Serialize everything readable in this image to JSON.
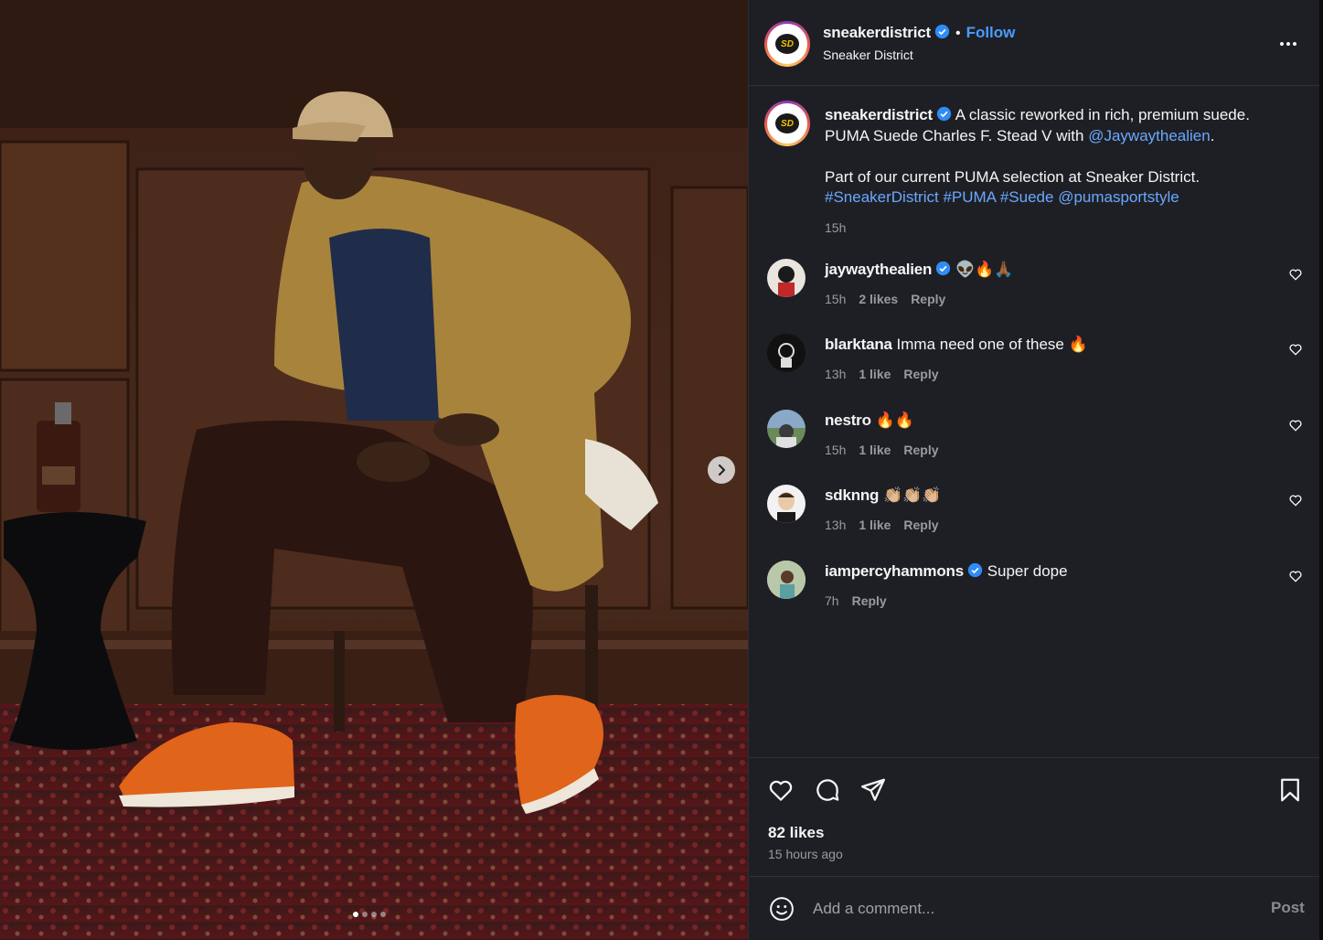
{
  "header": {
    "username": "sneakerdistrict",
    "follow_label": "Follow",
    "separator": "•",
    "subtitle": "Sneaker District",
    "avatar_initials": "SD"
  },
  "caption": {
    "username": "sneakerdistrict",
    "line1": "A classic reworked in rich, premium suede.",
    "line2_text": "PUMA Suede Charles F. Stead V with ",
    "line2_mention": "@Jaywaythealien",
    "line2_end": ".",
    "line3": "Part of our current PUMA selection at Sneaker District.",
    "hashtags": [
      "#SneakerDistrict",
      "#PUMA",
      "#Suede",
      "@pumasportstyle"
    ],
    "time": "15h"
  },
  "comments": [
    {
      "username": "jaywaythealien",
      "verified": true,
      "text": "👽🔥🙏🏾",
      "time": "15h",
      "likes": "2 likes",
      "reply": "Reply"
    },
    {
      "username": "blarktana",
      "verified": false,
      "text": "Imma need one of these 🔥",
      "time": "13h",
      "likes": "1 like",
      "reply": "Reply"
    },
    {
      "username": "nestro",
      "verified": false,
      "text": "🔥🔥",
      "time": "15h",
      "likes": "1 like",
      "reply": "Reply"
    },
    {
      "username": "sdknng",
      "verified": false,
      "text": "👏🏼👏🏼👏🏼",
      "time": "13h",
      "likes": "1 like",
      "reply": "Reply"
    },
    {
      "username": "iampercyhammons",
      "verified": true,
      "text": "Super dope",
      "time": "7h",
      "likes": "",
      "reply": "Reply"
    }
  ],
  "actions": {
    "likes": "82 likes",
    "time_ago": "15 hours ago"
  },
  "add_comment": {
    "placeholder": "Add a comment...",
    "post_label": "Post"
  },
  "carousel": {
    "count": 4,
    "active": 1
  },
  "colors": {
    "accent": "#4a9cff",
    "panel_bg": "#1e1f24",
    "text": "#f5f5f5",
    "muted": "#9a9aa0",
    "verified": "#2f8cf6"
  }
}
